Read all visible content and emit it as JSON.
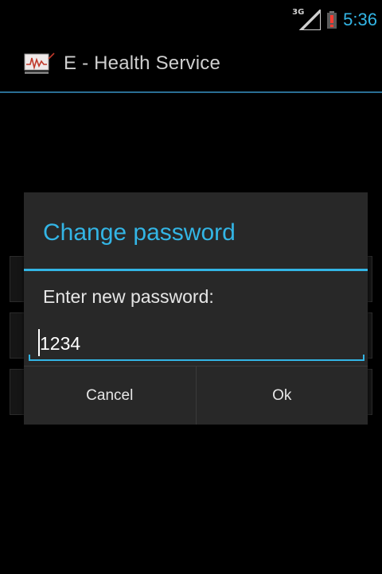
{
  "status_bar": {
    "network_type": "3G",
    "time": "5:36",
    "battery_icon": "battery-alert-icon",
    "signal_icon": "signal-icon"
  },
  "action_bar": {
    "app_icon": "heart-monitor-icon",
    "title": "E - Health Service"
  },
  "dialog": {
    "title": "Change password",
    "message": "Enter new password:",
    "input_value": "1234",
    "buttons": {
      "cancel": "Cancel",
      "ok": "Ok"
    }
  },
  "colors": {
    "accent": "#33b5e5",
    "background": "#000000",
    "dialog_background": "#282828",
    "text_primary": "#e6e6e6"
  }
}
